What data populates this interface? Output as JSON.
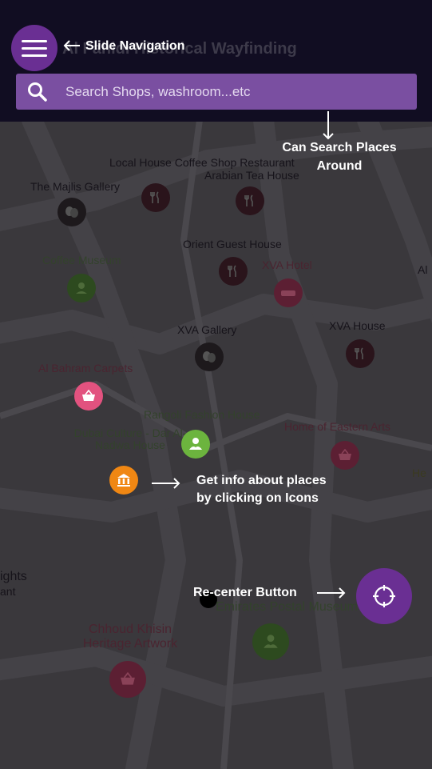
{
  "app": {
    "title": "Al Fahidi Historical Wayfinding"
  },
  "search": {
    "placeholder": "Search Shops, washroom...etc"
  },
  "places": [
    {
      "name": "Local House Coffee Shop Restaurant",
      "icon": "restaurant-icon"
    },
    {
      "name": "The Majlis Gallery",
      "icon": "gallery-icon"
    },
    {
      "name": "Arabian Tea House",
      "icon": "restaurant-icon"
    },
    {
      "name": "Coffee Museum",
      "icon": "museum-icon"
    },
    {
      "name": "Orient Guest House",
      "icon": "restaurant-icon"
    },
    {
      "name": "XVA Hotel",
      "icon": "hotel-icon"
    },
    {
      "name": "XVA Gallery",
      "icon": "gallery-icon"
    },
    {
      "name": "XVA House",
      "icon": "restaurant-icon"
    },
    {
      "name": "Al Bahram Carpets",
      "icon": "shopping-basket-icon"
    },
    {
      "name": "Rangoli Fashion House",
      "icon": ""
    },
    {
      "name": "Dubai Culture - Dar Al-Nadwa House",
      "icon": "museum-icon"
    },
    {
      "name": "Home of Eastern Arts",
      "icon": "shopping-basket-icon"
    },
    {
      "name": "Emirates Postal Museum",
      "icon": "museum-icon"
    },
    {
      "name": "Chhoud Khisin Heritage Artwork",
      "icon": "shopping-basket-icon"
    }
  ],
  "edge_labels": {
    "right_al": "Al",
    "right_he": "He",
    "left_lights": "ights",
    "left_ant": "ant"
  },
  "annotations": {
    "slide_navigation": "Slide Navigation",
    "search_places": [
      "Can Search Places",
      "Around"
    ],
    "info_places": [
      "Get info about places",
      "by clicking on Icons"
    ],
    "recenter": "Re-center Button"
  },
  "colors": {
    "accent": "#6a2f93",
    "search_bg": "#7a4fa1",
    "header_bg": "#110d22",
    "overlay_map": "#3a383c",
    "poi_pink": "#e2527f",
    "poi_lime": "#6cb43e",
    "poi_orange": "#f08713"
  }
}
